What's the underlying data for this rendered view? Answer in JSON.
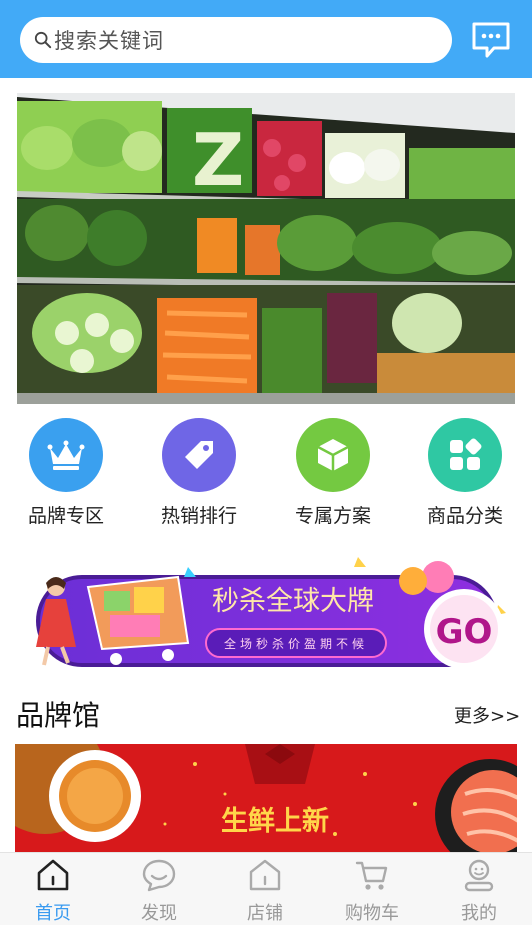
{
  "search": {
    "placeholder": "搜索关键词"
  },
  "categories": [
    {
      "label": "品牌专区",
      "icon": "crown-icon",
      "color": "#3aa0ef"
    },
    {
      "label": "热销排行",
      "icon": "tag-icon",
      "color": "#6f66e6"
    },
    {
      "label": "专属方案",
      "icon": "cube-icon",
      "color": "#74c941"
    },
    {
      "label": "商品分类",
      "icon": "grid-icon",
      "color": "#2fc8a3"
    }
  ],
  "banner": {
    "sign_letter": "Z"
  },
  "promo": {
    "title": "秒杀全球大牌",
    "subtitle": "全场秒杀价盈期不候",
    "go": "GO"
  },
  "section": {
    "title": "品牌馆",
    "more": "更多>>"
  },
  "brand_banner": {
    "text": "生鲜上新"
  },
  "tabs": [
    {
      "label": "首页",
      "icon": "home-icon",
      "active": true
    },
    {
      "label": "发现",
      "icon": "chat-bubble-icon",
      "active": false
    },
    {
      "label": "店铺",
      "icon": "store-icon",
      "active": false
    },
    {
      "label": "购物车",
      "icon": "cart-icon",
      "active": false
    },
    {
      "label": "我的",
      "icon": "user-icon",
      "active": false
    }
  ],
  "colors": {
    "header": "#42aaf7",
    "active_tab": "#3a9bf0",
    "inactive_tab": "#999999"
  }
}
